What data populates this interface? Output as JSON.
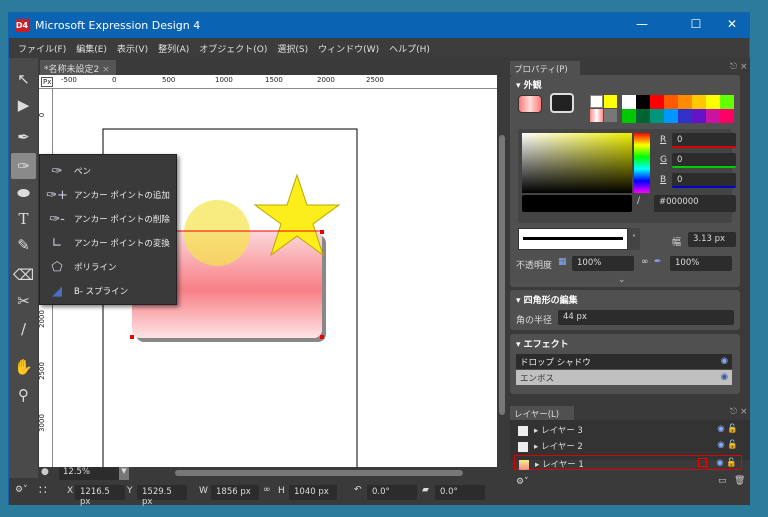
{
  "window": {
    "title": "Microsoft Expression Design 4",
    "logo": "D4"
  },
  "menu": [
    "ファイル(F)",
    "編集(E)",
    "表示(V)",
    "整列(A)",
    "オブジェクト(O)",
    "選択(S)",
    "ウィンドウ(W)",
    "ヘルプ(H)"
  ],
  "document": {
    "tab": "*名称未設定2",
    "ruler_unit": "Px",
    "h_ruler": [
      "-500",
      "0",
      "500",
      "1000",
      "1500",
      "2000",
      "2500"
    ],
    "v_ruler": [
      "0",
      "2000",
      "2500",
      "3000"
    ],
    "zoom": "12.5%"
  },
  "tools": [
    "selection-icon",
    "direct-selection-icon",
    "brush-icon",
    "pen-icon",
    "ellipse-icon",
    "text-icon",
    "knife-icon",
    "eraser-icon",
    "scissors-icon",
    "eyedropper-icon",
    "hand-icon",
    "zoom-icon"
  ],
  "flyout": [
    "ペン",
    "アンカー ポイントの追加",
    "アンカー ポイントの削除",
    "アンカー ポイントの変換",
    "ポリライン",
    "B- スプライン"
  ],
  "properties": {
    "tab": "プロパティ(P)",
    "appearance": "外観",
    "r_label": "R",
    "r": "0",
    "g_label": "G",
    "g": "0",
    "b_label": "B",
    "b": "0",
    "hex": "#000000",
    "width_label": "幅",
    "width": "3.13 px",
    "opacity_label": "不透明度",
    "opacity": "100%",
    "opacity2": "100%",
    "swatches": [
      "#ffffff",
      "#000000",
      "#ff0000",
      "#ff5a00",
      "#ff8c00",
      "#ffc800",
      "#ffff00",
      "#64ff00",
      "#00c800",
      "#006432",
      "#00967d",
      "#0096ff",
      "#3232c8",
      "#6414c8",
      "#c814a0",
      "#ff0064"
    ],
    "rect_section": "四角形の編集",
    "radius_label": "角の半径",
    "radius": "44 px",
    "effects_section": "エフェクト",
    "effects": [
      "ドロップ シャドウ",
      "エンボス"
    ]
  },
  "layers": {
    "tab": "レイヤー(L)",
    "items": [
      "レイヤー 3",
      "レイヤー 2",
      "レイヤー 1"
    ],
    "selected": "レイヤー 1"
  },
  "status": {
    "x_label": "X",
    "x": "1216.5 px",
    "y_label": "Y",
    "y": "1529.5 px",
    "w_label": "W",
    "w": "1856 px",
    "h_label": "H",
    "h": "1040 px",
    "rotation": "0.0°",
    "skew": "0.0°"
  }
}
